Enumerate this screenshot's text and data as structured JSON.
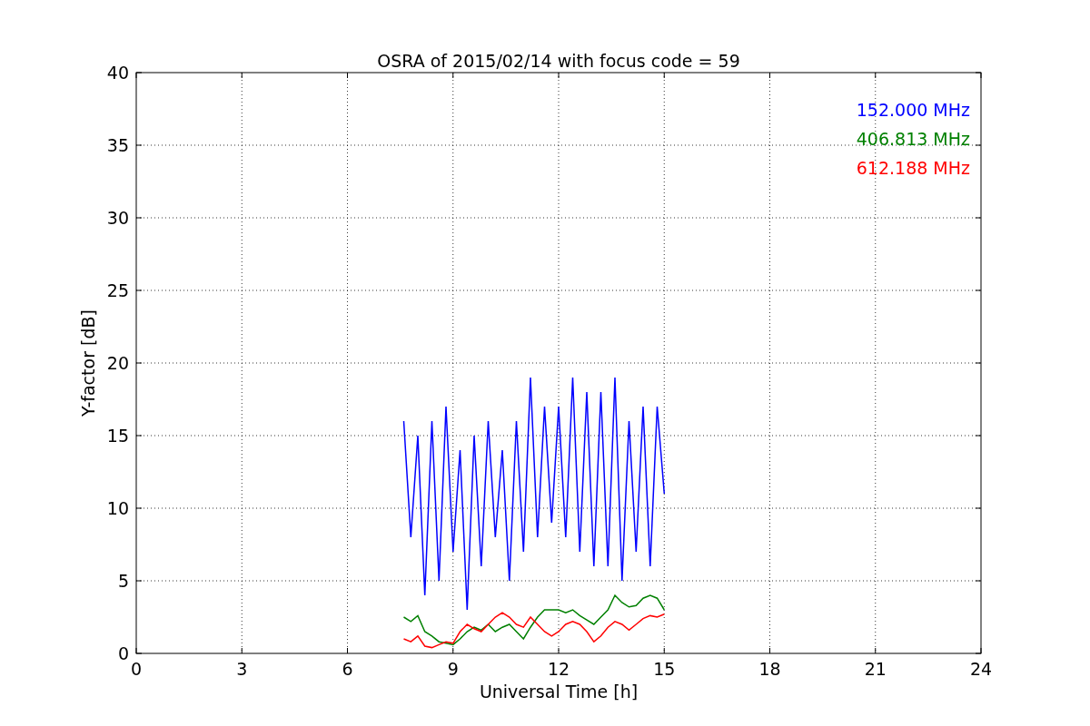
{
  "chart_data": {
    "type": "line",
    "title": "OSRA of 2015/02/14 with focus code = 59",
    "xlabel": "Universal Time [h]",
    "ylabel": "Y-factor [dB]",
    "x": [
      7.6,
      7.8,
      8.0,
      8.2,
      8.4,
      8.6,
      8.8,
      9.0,
      9.2,
      9.4,
      9.6,
      9.8,
      10.0,
      10.2,
      10.4,
      10.6,
      10.8,
      11.0,
      11.2,
      11.4,
      11.6,
      11.8,
      12.0,
      12.2,
      12.4,
      12.6,
      12.8,
      13.0,
      13.2,
      13.4,
      13.6,
      13.8,
      14.0,
      14.2,
      14.4,
      14.6,
      14.8,
      15.0
    ],
    "series": [
      {
        "name": "152.000 MHz",
        "color": "#0000ff",
        "values": [
          16,
          8,
          15,
          4,
          16,
          5,
          17,
          7,
          14,
          3,
          15,
          6,
          16,
          8,
          14,
          5,
          16,
          7,
          19,
          8,
          17,
          9,
          17,
          8,
          19,
          7,
          18,
          6,
          18,
          6,
          19,
          5,
          16,
          7,
          17,
          6,
          17,
          11
        ]
      },
      {
        "name": "406.813 MHz",
        "color": "#008000",
        "values": [
          2.5,
          2.2,
          2.6,
          1.5,
          1.2,
          0.8,
          0.7,
          0.6,
          1.0,
          1.5,
          1.8,
          1.6,
          2.0,
          1.5,
          1.8,
          2.0,
          1.5,
          1.0,
          1.8,
          2.5,
          3.0,
          3.0,
          3.0,
          2.8,
          3.0,
          2.6,
          2.3,
          2.0,
          2.5,
          3.0,
          4.0,
          3.5,
          3.2,
          3.3,
          3.8,
          4.0,
          3.8,
          3.0
        ]
      },
      {
        "name": "612.188 MHz",
        "color": "#ff0000",
        "values": [
          1.0,
          0.8,
          1.2,
          0.5,
          0.4,
          0.6,
          0.8,
          0.7,
          1.5,
          2.0,
          1.7,
          1.5,
          2.0,
          2.5,
          2.8,
          2.5,
          2.0,
          1.8,
          2.5,
          2.0,
          1.5,
          1.2,
          1.5,
          2.0,
          2.2,
          2.0,
          1.5,
          0.8,
          1.2,
          1.8,
          2.2,
          2.0,
          1.6,
          2.0,
          2.4,
          2.6,
          2.5,
          2.7
        ]
      }
    ],
    "grid": true,
    "xlim": [
      0,
      24
    ],
    "ylim": [
      0,
      40
    ],
    "xticks": [
      0,
      3,
      6,
      9,
      12,
      15,
      18,
      21,
      24
    ],
    "yticks": [
      0,
      5,
      10,
      15,
      20,
      25,
      30,
      35,
      40
    ]
  }
}
